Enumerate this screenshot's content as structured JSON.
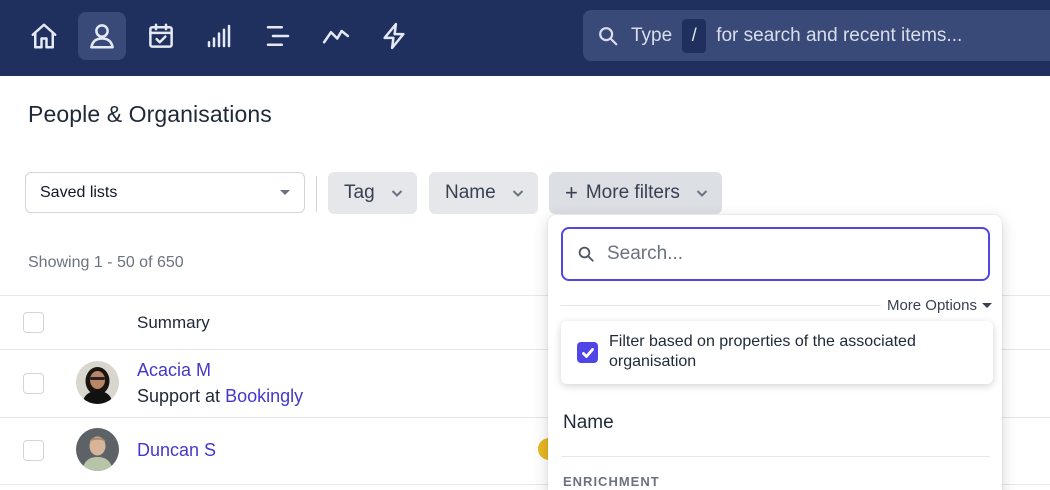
{
  "nav": {
    "items": [
      {
        "icon": "home-icon",
        "active": false
      },
      {
        "icon": "person-icon",
        "active": true
      },
      {
        "icon": "calendar-check-icon",
        "active": false
      },
      {
        "icon": "bar-signal-icon",
        "active": false
      },
      {
        "icon": "list-icon",
        "active": false
      },
      {
        "icon": "trend-line-icon",
        "active": false
      },
      {
        "icon": "lightning-icon",
        "active": false
      }
    ],
    "search": {
      "prefix": "Type",
      "key": "/",
      "suffix": "for search and recent items..."
    }
  },
  "page": {
    "title": "People & Organisations"
  },
  "filters": {
    "saved_lists": "Saved lists",
    "tag": "Tag",
    "name": "Name",
    "more_filters": "More filters",
    "plus": "+"
  },
  "showing": "Showing 1 - 50 of 650",
  "table": {
    "header": {
      "summary": "Summary"
    },
    "rows": [
      {
        "name": "Acacia M",
        "role": "Support at",
        "organisation": "Bookingly"
      },
      {
        "name": "Duncan S"
      }
    ]
  },
  "dropdown": {
    "search_placeholder": "Search...",
    "more_options": "More Options",
    "associated_filter": {
      "label": "Filter based on properties of the associated organisation",
      "checked": true
    },
    "options": [
      "Name"
    ],
    "section": "ENRICHMENT"
  },
  "colors": {
    "nav_bg": "#1f2f5e",
    "accent": "#4f46e5",
    "link": "#4338ca"
  }
}
